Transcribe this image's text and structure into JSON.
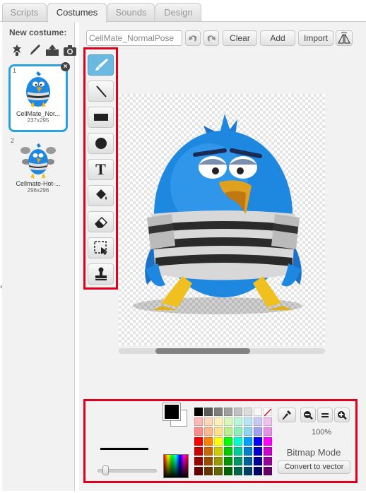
{
  "tabs": [
    {
      "label": "Scripts",
      "active": false
    },
    {
      "label": "Costumes",
      "active": true
    },
    {
      "label": "Sounds",
      "active": false
    },
    {
      "label": "Design",
      "active": false
    }
  ],
  "left_pane": {
    "new_costume_label": "New costume:",
    "new_costume_icons": [
      "choose-from-library-icon",
      "paint-brush-icon",
      "upload-icon",
      "camera-icon"
    ],
    "costumes": [
      {
        "number": "1",
        "name": "CellMate_Nor...",
        "size": "237x295",
        "selected": true
      },
      {
        "number": "2",
        "name": "Cellmate-Hot-...",
        "size": "296x296",
        "selected": false
      }
    ]
  },
  "editor": {
    "costume_name_value": "CellMate_NormalPose",
    "undo_icon": "undo-icon",
    "redo_icon": "redo-icon",
    "clear_label": "Clear",
    "add_label": "Add",
    "import_label": "Import",
    "flip_icon": "flip-horizontal-icon",
    "tools": [
      {
        "name": "brush-tool",
        "icon": "brush-icon",
        "active": true
      },
      {
        "name": "line-tool",
        "icon": "line-icon",
        "active": false
      },
      {
        "name": "rectangle-tool",
        "icon": "rectangle-icon",
        "active": false
      },
      {
        "name": "ellipse-tool",
        "icon": "ellipse-icon",
        "active": false
      },
      {
        "name": "text-tool",
        "icon": "text-icon",
        "active": false
      },
      {
        "name": "fill-tool",
        "icon": "paint-bucket-icon",
        "active": false
      },
      {
        "name": "eraser-tool",
        "icon": "eraser-icon",
        "active": false
      },
      {
        "name": "select-tool",
        "icon": "select-icon",
        "active": false
      },
      {
        "name": "stamp-tool",
        "icon": "stamp-icon",
        "active": false
      }
    ],
    "text_tool_glyph": "T",
    "zoom_level": "100%",
    "mode_label": "Bitmap Mode",
    "convert_label": "Convert to vector",
    "primary_color": "#000000",
    "secondary_color": "#ffffff",
    "highlight_color": "#e0001b",
    "accent_color": "#2ba3da",
    "palette": [
      "#000000",
      "#5a5a5a",
      "#7e7e7e",
      "#a0a0a0",
      "#c2c2c2",
      "#dcdcdc",
      "#f6f6f6",
      "transparent",
      "#ffb8b8",
      "#ffd7b8",
      "#fff0b8",
      "#d8f8b8",
      "#b8f8d8",
      "#b8e4f8",
      "#c8c8f8",
      "#f0c0f0",
      "#ff8c8c",
      "#ffb88c",
      "#ffe08c",
      "#b8f08c",
      "#8cf0b8",
      "#8cd4f0",
      "#a0a0f0",
      "#e890e8",
      "#ff0000",
      "#ff7f00",
      "#ffff00",
      "#00ff00",
      "#00ffcc",
      "#00a0ff",
      "#0000ff",
      "#ff00ff",
      "#cc0000",
      "#cc6600",
      "#cccc00",
      "#00cc00",
      "#00cc99",
      "#0080cc",
      "#0000cc",
      "#cc00cc",
      "#990000",
      "#994c00",
      "#999900",
      "#009900",
      "#009966",
      "#006099",
      "#000099",
      "#990099",
      "#660000",
      "#663300",
      "#666600",
      "#006600",
      "#006644",
      "#004066",
      "#000066",
      "#660066"
    ]
  }
}
